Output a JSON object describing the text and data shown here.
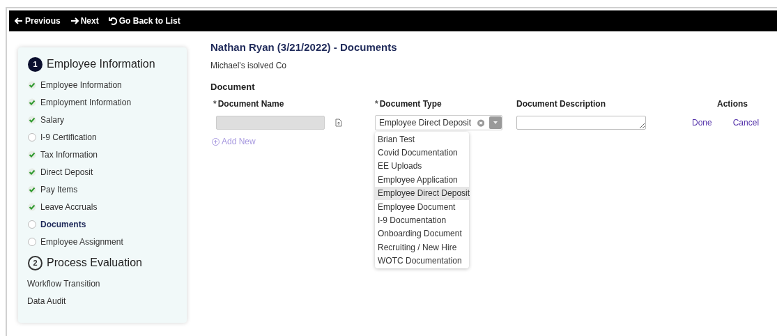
{
  "nav": [
    {
      "kind": "previous",
      "label": "Previous"
    },
    {
      "kind": "next",
      "label": "Next"
    },
    {
      "kind": "back",
      "label": "Go Back to List"
    }
  ],
  "sidebar": {
    "sections": [
      {
        "number": "1",
        "title": "Employee Information",
        "active": true,
        "items": [
          {
            "label": "Employee Information",
            "done": true,
            "selected": false
          },
          {
            "label": "Employment Information",
            "done": true,
            "selected": false
          },
          {
            "label": "Salary",
            "done": true,
            "selected": false
          },
          {
            "label": "I-9 Certification",
            "done": false,
            "selected": false
          },
          {
            "label": "Tax Information",
            "done": true,
            "selected": false
          },
          {
            "label": "Direct Deposit",
            "done": true,
            "selected": false
          },
          {
            "label": "Pay Items",
            "done": true,
            "selected": false
          },
          {
            "label": "Leave Accruals",
            "done": true,
            "selected": false
          },
          {
            "label": "Documents",
            "done": false,
            "selected": true
          },
          {
            "label": "Employee Assignment",
            "done": false,
            "selected": false
          }
        ]
      },
      {
        "number": "2",
        "title": "Process Evaluation",
        "active": false,
        "links": [
          "Workflow Transition",
          "Data Audit"
        ]
      }
    ]
  },
  "title": "Nathan Ryan (3/21/2022) - Documents",
  "company": "Michael's isolved Co",
  "section_title": "Document",
  "columns": [
    {
      "label": "Document Name",
      "required": true
    },
    {
      "label": "Document Type",
      "required": true
    },
    {
      "label": "Document Description",
      "required": false
    },
    {
      "label": "Actions",
      "required": false
    }
  ],
  "required_mark": "*",
  "row": {
    "document_type": "Employee Direct Deposit",
    "actions": [
      "Done",
      "Cancel"
    ]
  },
  "add_new": "Add New",
  "dropdown": [
    {
      "label": "Brian Test",
      "selected": false
    },
    {
      "label": "Covid Documentation",
      "selected": false
    },
    {
      "label": "EE Uploads",
      "selected": false
    },
    {
      "label": "Employee Application",
      "selected": false
    },
    {
      "label": "Employee Direct Deposit",
      "selected": true
    },
    {
      "label": "Employee Document",
      "selected": false
    },
    {
      "label": "I-9 Documentation",
      "selected": false
    },
    {
      "label": "Onboarding Document",
      "selected": false
    },
    {
      "label": "Recruiting / New Hire",
      "selected": false
    },
    {
      "label": "WOTC Documentation",
      "selected": false
    }
  ]
}
